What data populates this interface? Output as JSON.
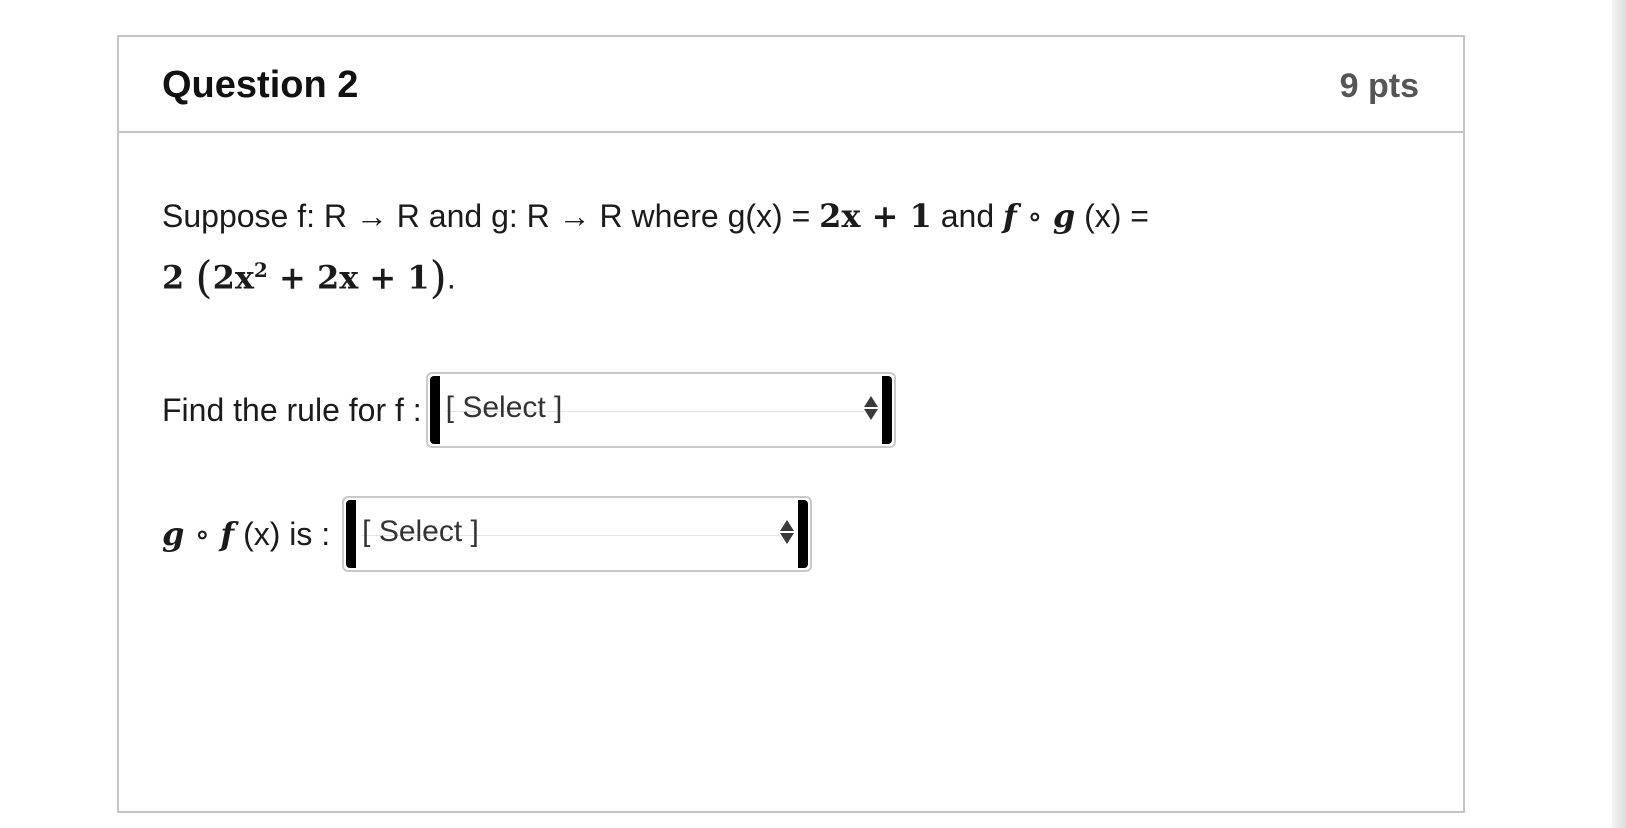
{
  "question": {
    "title": "Question 2",
    "points": "9 pts"
  },
  "stem": {
    "part1": "Suppose f: R → R and g: R → R where  g(x) = ",
    "g_expr": "2x + 1",
    "part2": " and ",
    "f_sym": "f",
    "compose": " ∘ ",
    "g_sym": "g",
    "part3": " (x) =",
    "expr_coef": "2 ",
    "paren_open": "(",
    "expr_inner_a": "2x",
    "expr_exp": "2",
    "expr_inner_b": " + 2x + 1",
    "paren_close": ")",
    "period": "."
  },
  "fields": [
    {
      "label": "Find the rule for f :",
      "value": "[ Select ]"
    },
    {
      "label_g": "g",
      "label_compose": " ∘ ",
      "label_f": "f",
      "label_suffix": " (x) is :",
      "value": "[ Select ]"
    }
  ],
  "icons": {
    "dropdown": "updown-chevron-icon"
  },
  "colors": {
    "border": "#c4c4c4",
    "title": "#111111",
    "points": "#555555"
  }
}
